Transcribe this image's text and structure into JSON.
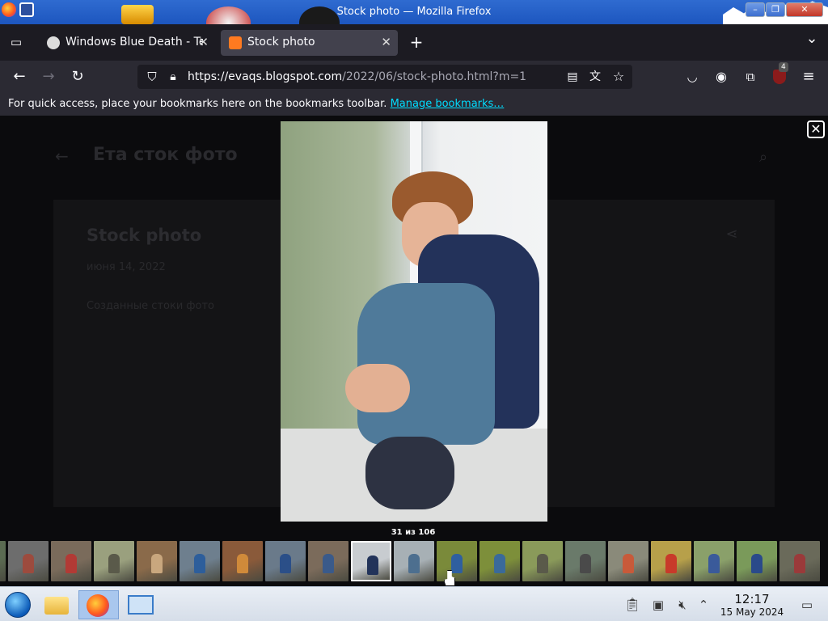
{
  "window": {
    "title": "Stock photo — Mozilla Firefox",
    "minimize_label": "–",
    "maximize_label": "❐",
    "close_label": "✕"
  },
  "tabs": [
    {
      "label": "Windows Blue Death - Te",
      "close": "✕",
      "active": false
    },
    {
      "label": "Stock photo",
      "close": "✕",
      "active": true
    }
  ],
  "toolbar": {
    "new_tab": "+",
    "tab_list": "⌄",
    "back": "←",
    "forward": "→",
    "reload": "↻",
    "menu": "≡"
  },
  "urlbar": {
    "url_host": "https://evaqs.blogspot.com",
    "url_path": "/2022/06/stock-photo.html?m=1"
  },
  "extensions": {
    "ublock_badge": "4"
  },
  "bookmarks_bar": {
    "message": "For quick access, place your bookmarks here on the bookmarks toolbar.",
    "link": "Manage bookmarks…"
  },
  "page": {
    "blog_title": "Ета сток фото",
    "post_title": "Stock photo",
    "post_date": "июня 14, 2022",
    "post_note": "Созданные стоки фото"
  },
  "lightbox": {
    "close_label": "✕",
    "counter": "31 из 106",
    "selected_index": 9
  },
  "taskbar": {
    "time": "12:17",
    "date": "15 May 2024"
  },
  "icons": [
    "firefox-icon",
    "search-icon",
    "close-icon",
    "shield-icon",
    "lock-icon",
    "reader-icon",
    "translate-icon",
    "star-icon",
    "pocket-icon",
    "account-icon",
    "extensions-icon",
    "ublock-icon",
    "start-orb-icon",
    "folder-icon",
    "volume-muted-icon",
    "clipboard-icon",
    "show-desktop-icon"
  ]
}
